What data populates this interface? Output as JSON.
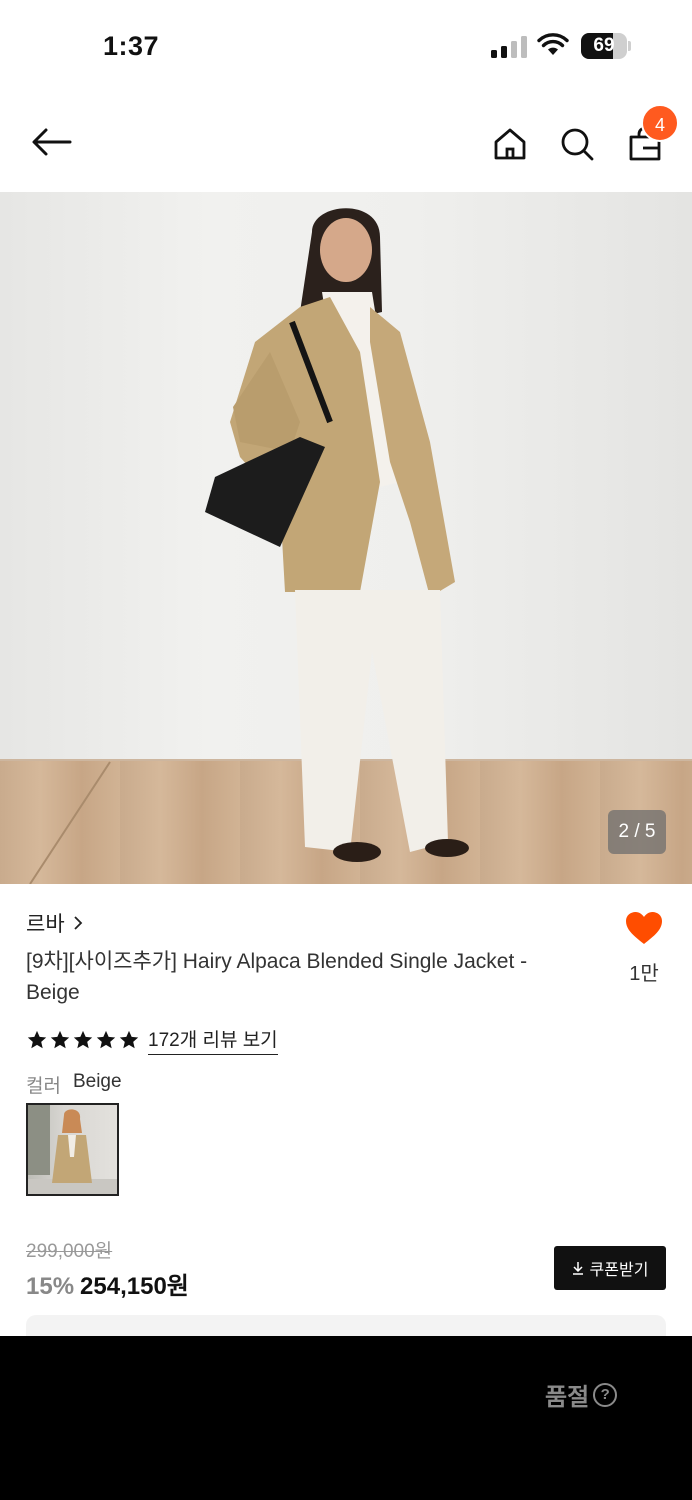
{
  "status_bar": {
    "time": "1:37",
    "battery_level": "69",
    "signal_bars_active": 2,
    "signal_bars_total": 4
  },
  "nav": {
    "back_icon": "arrow-left-icon",
    "home_icon": "home-icon",
    "search_icon": "search-icon",
    "cart_icon": "shopping-bag-icon",
    "cart_count": "4"
  },
  "gallery": {
    "counter": "2 / 5",
    "current_image": 2,
    "total_images": 5
  },
  "product": {
    "brand": "르바",
    "title": "[9차][사이즈추가] Hairy Alpaca Blended Single Jacket - Beige",
    "like_count": "1만",
    "rating_stars": 5,
    "review_link": "172개 리뷰 보기",
    "color_label": "컬러",
    "color_value": "Beige",
    "original_price": "299,000원",
    "discount": "15%",
    "sale_price": "254,150원",
    "coupon_button": "쿠폰받기"
  },
  "bottom_bar": {
    "like_icon": "heart-icon",
    "share_icon": "share-icon",
    "status_label": "품절",
    "help_icon": "question-circle-icon",
    "help_symbol": "?"
  },
  "colors": {
    "accent": "#ff5a1f",
    "heart": "#ff4d00",
    "bar_bg": "#000000",
    "muted": "#8a8a8a"
  }
}
